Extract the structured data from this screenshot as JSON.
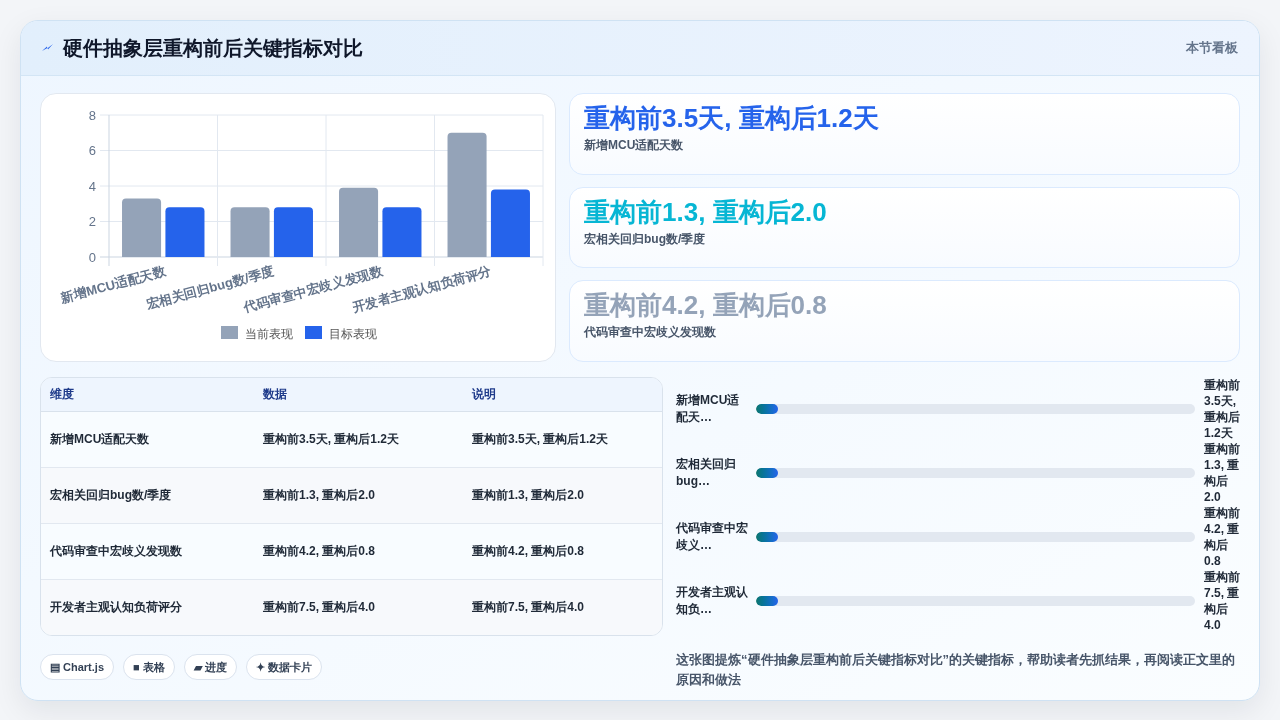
{
  "header": {
    "title": "硬件抽象层重构前后关键指标对比",
    "badge": "本节看板"
  },
  "chart": {
    "chart_data": {
      "type": "bar",
      "categories": [
        "新增MCU适配天数",
        "宏相关回归bug数/季度",
        "代码审查中宏歧义发现数",
        "开发者主观认知负荷评分"
      ],
      "series": [
        {
          "name": "当前表现",
          "color": "#94a3b8",
          "values": [
            3.3,
            2.8,
            3.9,
            7.0
          ]
        },
        {
          "name": "目标表现",
          "color": "#2563eb",
          "values": [
            2.8,
            2.8,
            2.8,
            3.8
          ]
        }
      ],
      "ylim": [
        0,
        8
      ],
      "yticks": [
        0,
        2,
        4,
        6,
        8
      ],
      "grid": true,
      "legend": "bottom"
    }
  },
  "stat_cards": [
    {
      "value": "重构前3.5天, 重构后1.2天",
      "label": "新增MCU适配天数",
      "color": "#2563eb"
    },
    {
      "value": "重构前1.3, 重构后2.0",
      "label": "宏相关回归bug数/季度",
      "color": "#06b6d4"
    },
    {
      "value": "重构前4.2, 重构后0.8",
      "label": "代码审查中宏歧义发现数",
      "color": "#94a3b8"
    }
  ],
  "table": {
    "columns": [
      "维度",
      "数据",
      "说明"
    ],
    "rows": [
      [
        "新增MCU适配天数",
        "重构前3.5天, 重构后1.2天",
        "重构前3.5天, 重构后1.2天"
      ],
      [
        "宏相关回归bug数/季度",
        "重构前1.3, 重构后2.0",
        "重构前1.3, 重构后2.0"
      ],
      [
        "代码审查中宏歧义发现数",
        "重构前4.2, 重构后0.8",
        "重构前4.2, 重构后0.8"
      ],
      [
        "开发者主观认知负荷评分",
        "重构前7.5, 重构后4.0",
        "重构前7.5, 重构后4.0"
      ]
    ]
  },
  "progress": [
    {
      "label": "新增MCU适配天…",
      "level": 0.05,
      "reading": "重构前3.5天, 重构后1.2天"
    },
    {
      "label": "宏相关回归bug…",
      "level": 0.05,
      "reading": "重构前1.3, 重构后2.0"
    },
    {
      "label": "代码审查中宏歧义…",
      "level": 0.05,
      "reading": "重构前4.2, 重构后0.8"
    },
    {
      "label": "开发者主观认知负…",
      "level": 0.05,
      "reading": "重构前7.5, 重构后4.0"
    }
  ],
  "tags": [
    "▤ Chart.js",
    "■ 表格",
    "▰ 进度",
    "✦ 数据卡片"
  ],
  "caption": "这张图提炼“硬件抽象层重构前后关键指标对比”的关键指标，帮助读者先抓结果，再阅读正文里的原因和做法"
}
